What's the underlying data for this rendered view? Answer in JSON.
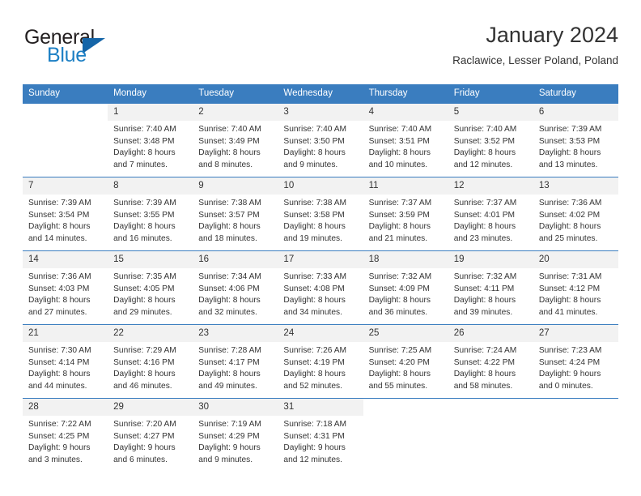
{
  "brand": {
    "name_part1": "General",
    "name_part2": "Blue",
    "flag_icon": "blue-triangle-flag-icon",
    "accent_color": "#1c7fc4"
  },
  "header": {
    "title": "January 2024",
    "subtitle": "Raclawice, Lesser Poland, Poland"
  },
  "theme": {
    "header_bar_color": "#3a7dbf",
    "day_number_band_color": "#f2f2f2",
    "text_color": "#333333"
  },
  "weekdays": [
    "Sunday",
    "Monday",
    "Tuesday",
    "Wednesday",
    "Thursday",
    "Friday",
    "Saturday"
  ],
  "weeks": [
    [
      {
        "day": "",
        "sunrise": "",
        "sunset": "",
        "daylight1": "",
        "daylight2": ""
      },
      {
        "day": "1",
        "sunrise": "Sunrise: 7:40 AM",
        "sunset": "Sunset: 3:48 PM",
        "daylight1": "Daylight: 8 hours",
        "daylight2": "and 7 minutes."
      },
      {
        "day": "2",
        "sunrise": "Sunrise: 7:40 AM",
        "sunset": "Sunset: 3:49 PM",
        "daylight1": "Daylight: 8 hours",
        "daylight2": "and 8 minutes."
      },
      {
        "day": "3",
        "sunrise": "Sunrise: 7:40 AM",
        "sunset": "Sunset: 3:50 PM",
        "daylight1": "Daylight: 8 hours",
        "daylight2": "and 9 minutes."
      },
      {
        "day": "4",
        "sunrise": "Sunrise: 7:40 AM",
        "sunset": "Sunset: 3:51 PM",
        "daylight1": "Daylight: 8 hours",
        "daylight2": "and 10 minutes."
      },
      {
        "day": "5",
        "sunrise": "Sunrise: 7:40 AM",
        "sunset": "Sunset: 3:52 PM",
        "daylight1": "Daylight: 8 hours",
        "daylight2": "and 12 minutes."
      },
      {
        "day": "6",
        "sunrise": "Sunrise: 7:39 AM",
        "sunset": "Sunset: 3:53 PM",
        "daylight1": "Daylight: 8 hours",
        "daylight2": "and 13 minutes."
      }
    ],
    [
      {
        "day": "7",
        "sunrise": "Sunrise: 7:39 AM",
        "sunset": "Sunset: 3:54 PM",
        "daylight1": "Daylight: 8 hours",
        "daylight2": "and 14 minutes."
      },
      {
        "day": "8",
        "sunrise": "Sunrise: 7:39 AM",
        "sunset": "Sunset: 3:55 PM",
        "daylight1": "Daylight: 8 hours",
        "daylight2": "and 16 minutes."
      },
      {
        "day": "9",
        "sunrise": "Sunrise: 7:38 AM",
        "sunset": "Sunset: 3:57 PM",
        "daylight1": "Daylight: 8 hours",
        "daylight2": "and 18 minutes."
      },
      {
        "day": "10",
        "sunrise": "Sunrise: 7:38 AM",
        "sunset": "Sunset: 3:58 PM",
        "daylight1": "Daylight: 8 hours",
        "daylight2": "and 19 minutes."
      },
      {
        "day": "11",
        "sunrise": "Sunrise: 7:37 AM",
        "sunset": "Sunset: 3:59 PM",
        "daylight1": "Daylight: 8 hours",
        "daylight2": "and 21 minutes."
      },
      {
        "day": "12",
        "sunrise": "Sunrise: 7:37 AM",
        "sunset": "Sunset: 4:01 PM",
        "daylight1": "Daylight: 8 hours",
        "daylight2": "and 23 minutes."
      },
      {
        "day": "13",
        "sunrise": "Sunrise: 7:36 AM",
        "sunset": "Sunset: 4:02 PM",
        "daylight1": "Daylight: 8 hours",
        "daylight2": "and 25 minutes."
      }
    ],
    [
      {
        "day": "14",
        "sunrise": "Sunrise: 7:36 AM",
        "sunset": "Sunset: 4:03 PM",
        "daylight1": "Daylight: 8 hours",
        "daylight2": "and 27 minutes."
      },
      {
        "day": "15",
        "sunrise": "Sunrise: 7:35 AM",
        "sunset": "Sunset: 4:05 PM",
        "daylight1": "Daylight: 8 hours",
        "daylight2": "and 29 minutes."
      },
      {
        "day": "16",
        "sunrise": "Sunrise: 7:34 AM",
        "sunset": "Sunset: 4:06 PM",
        "daylight1": "Daylight: 8 hours",
        "daylight2": "and 32 minutes."
      },
      {
        "day": "17",
        "sunrise": "Sunrise: 7:33 AM",
        "sunset": "Sunset: 4:08 PM",
        "daylight1": "Daylight: 8 hours",
        "daylight2": "and 34 minutes."
      },
      {
        "day": "18",
        "sunrise": "Sunrise: 7:32 AM",
        "sunset": "Sunset: 4:09 PM",
        "daylight1": "Daylight: 8 hours",
        "daylight2": "and 36 minutes."
      },
      {
        "day": "19",
        "sunrise": "Sunrise: 7:32 AM",
        "sunset": "Sunset: 4:11 PM",
        "daylight1": "Daylight: 8 hours",
        "daylight2": "and 39 minutes."
      },
      {
        "day": "20",
        "sunrise": "Sunrise: 7:31 AM",
        "sunset": "Sunset: 4:12 PM",
        "daylight1": "Daylight: 8 hours",
        "daylight2": "and 41 minutes."
      }
    ],
    [
      {
        "day": "21",
        "sunrise": "Sunrise: 7:30 AM",
        "sunset": "Sunset: 4:14 PM",
        "daylight1": "Daylight: 8 hours",
        "daylight2": "and 44 minutes."
      },
      {
        "day": "22",
        "sunrise": "Sunrise: 7:29 AM",
        "sunset": "Sunset: 4:16 PM",
        "daylight1": "Daylight: 8 hours",
        "daylight2": "and 46 minutes."
      },
      {
        "day": "23",
        "sunrise": "Sunrise: 7:28 AM",
        "sunset": "Sunset: 4:17 PM",
        "daylight1": "Daylight: 8 hours",
        "daylight2": "and 49 minutes."
      },
      {
        "day": "24",
        "sunrise": "Sunrise: 7:26 AM",
        "sunset": "Sunset: 4:19 PM",
        "daylight1": "Daylight: 8 hours",
        "daylight2": "and 52 minutes."
      },
      {
        "day": "25",
        "sunrise": "Sunrise: 7:25 AM",
        "sunset": "Sunset: 4:20 PM",
        "daylight1": "Daylight: 8 hours",
        "daylight2": "and 55 minutes."
      },
      {
        "day": "26",
        "sunrise": "Sunrise: 7:24 AM",
        "sunset": "Sunset: 4:22 PM",
        "daylight1": "Daylight: 8 hours",
        "daylight2": "and 58 minutes."
      },
      {
        "day": "27",
        "sunrise": "Sunrise: 7:23 AM",
        "sunset": "Sunset: 4:24 PM",
        "daylight1": "Daylight: 9 hours",
        "daylight2": "and 0 minutes."
      }
    ],
    [
      {
        "day": "28",
        "sunrise": "Sunrise: 7:22 AM",
        "sunset": "Sunset: 4:25 PM",
        "daylight1": "Daylight: 9 hours",
        "daylight2": "and 3 minutes."
      },
      {
        "day": "29",
        "sunrise": "Sunrise: 7:20 AM",
        "sunset": "Sunset: 4:27 PM",
        "daylight1": "Daylight: 9 hours",
        "daylight2": "and 6 minutes."
      },
      {
        "day": "30",
        "sunrise": "Sunrise: 7:19 AM",
        "sunset": "Sunset: 4:29 PM",
        "daylight1": "Daylight: 9 hours",
        "daylight2": "and 9 minutes."
      },
      {
        "day": "31",
        "sunrise": "Sunrise: 7:18 AM",
        "sunset": "Sunset: 4:31 PM",
        "daylight1": "Daylight: 9 hours",
        "daylight2": "and 12 minutes."
      },
      {
        "day": "",
        "sunrise": "",
        "sunset": "",
        "daylight1": "",
        "daylight2": ""
      },
      {
        "day": "",
        "sunrise": "",
        "sunset": "",
        "daylight1": "",
        "daylight2": ""
      },
      {
        "day": "",
        "sunrise": "",
        "sunset": "",
        "daylight1": "",
        "daylight2": ""
      }
    ]
  ]
}
